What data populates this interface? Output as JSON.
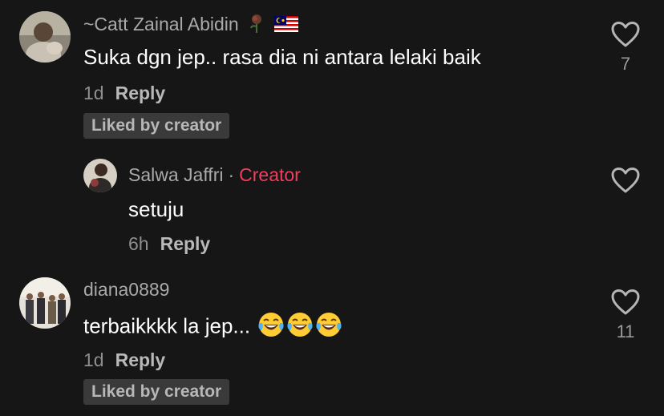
{
  "comments": [
    {
      "username": "~Catt Zainal Abidin",
      "text": "Suka dgn jep.. rasa dia ni antara lelaki baik",
      "time": "1d",
      "reply_label": "Reply",
      "liked_label": "Liked by creator",
      "like_count": "7",
      "icons": [
        "rose-icon",
        "malaysia-flag-icon"
      ]
    },
    {
      "username": "Salwa Jaffri",
      "dot": "·",
      "creator_label": "Creator",
      "text": "setuju",
      "time": "6h",
      "reply_label": "Reply",
      "like_count": ""
    },
    {
      "username": "diana0889",
      "text": "terbaikkkk la jep...",
      "emojis": [
        "tears-of-joy-emoji",
        "tears-of-joy-emoji",
        "tears-of-joy-emoji"
      ],
      "time": "1d",
      "reply_label": "Reply",
      "liked_label": "Liked by creator",
      "like_count": "11"
    }
  ],
  "colors": {
    "background": "#161616",
    "creator_tag": "#f23e5c",
    "liked_badge_bg": "#3a3a3a"
  }
}
